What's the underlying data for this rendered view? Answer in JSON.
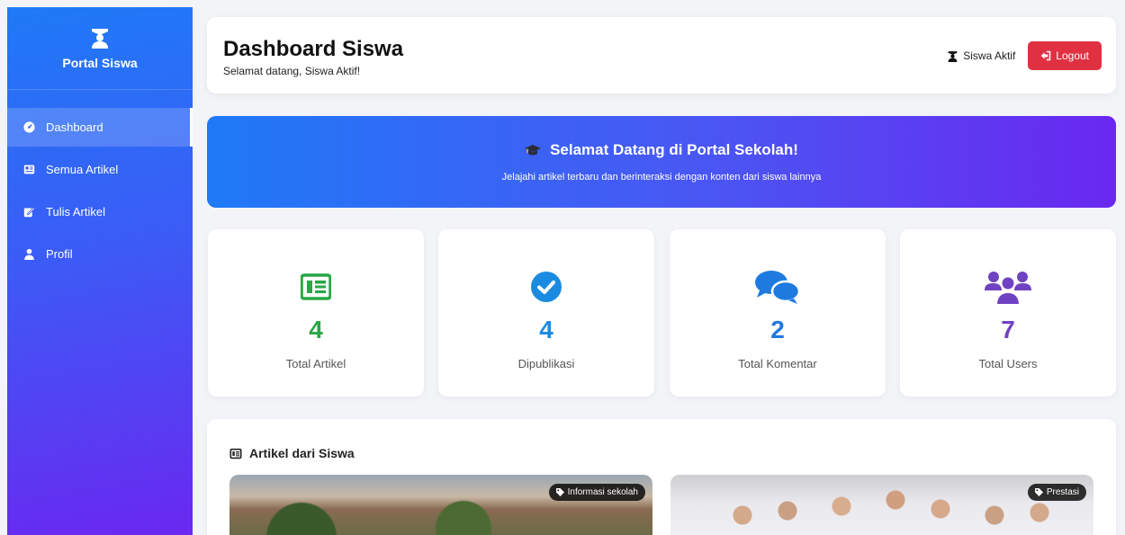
{
  "sidebar": {
    "brand": "Portal Siswa",
    "items": [
      {
        "label": "Dashboard",
        "icon": "dashboard-icon",
        "active": true
      },
      {
        "label": "Semua Artikel",
        "icon": "newspaper-icon",
        "active": false
      },
      {
        "label": "Tulis Artikel",
        "icon": "edit-icon",
        "active": false
      },
      {
        "label": "Profil",
        "icon": "user-icon",
        "active": false
      }
    ]
  },
  "header": {
    "title": "Dashboard Siswa",
    "subtitle": "Selamat datang, Siswa Aktif!",
    "user_name": "Siswa Aktif",
    "logout_label": "Logout"
  },
  "banner": {
    "title": "Selamat Datang di Portal Sekolah!",
    "subtitle": "Jelajahi artikel terbaru dan berinteraksi dengan konten dari siswa lainnya"
  },
  "stats": [
    {
      "value": "4",
      "label": "Total Artikel",
      "icon": "newspaper-icon",
      "color": "#28a745"
    },
    {
      "value": "4",
      "label": "Dipublikasi",
      "icon": "check-circle-icon",
      "color": "#1a8be0"
    },
    {
      "value": "2",
      "label": "Total Komentar",
      "icon": "comments-icon",
      "color": "#1f7ae0"
    },
    {
      "value": "7",
      "label": "Total Users",
      "icon": "users-icon",
      "color": "#6f42c1"
    }
  ],
  "articles": {
    "title": "Artikel dari Siswa",
    "cards": [
      {
        "tag": "Informasi sekolah"
      },
      {
        "tag": "Prestasi"
      }
    ]
  },
  "colors": {
    "accent": "#1f7af7",
    "accent_end": "#6a28f0",
    "logout": "#e03142"
  }
}
